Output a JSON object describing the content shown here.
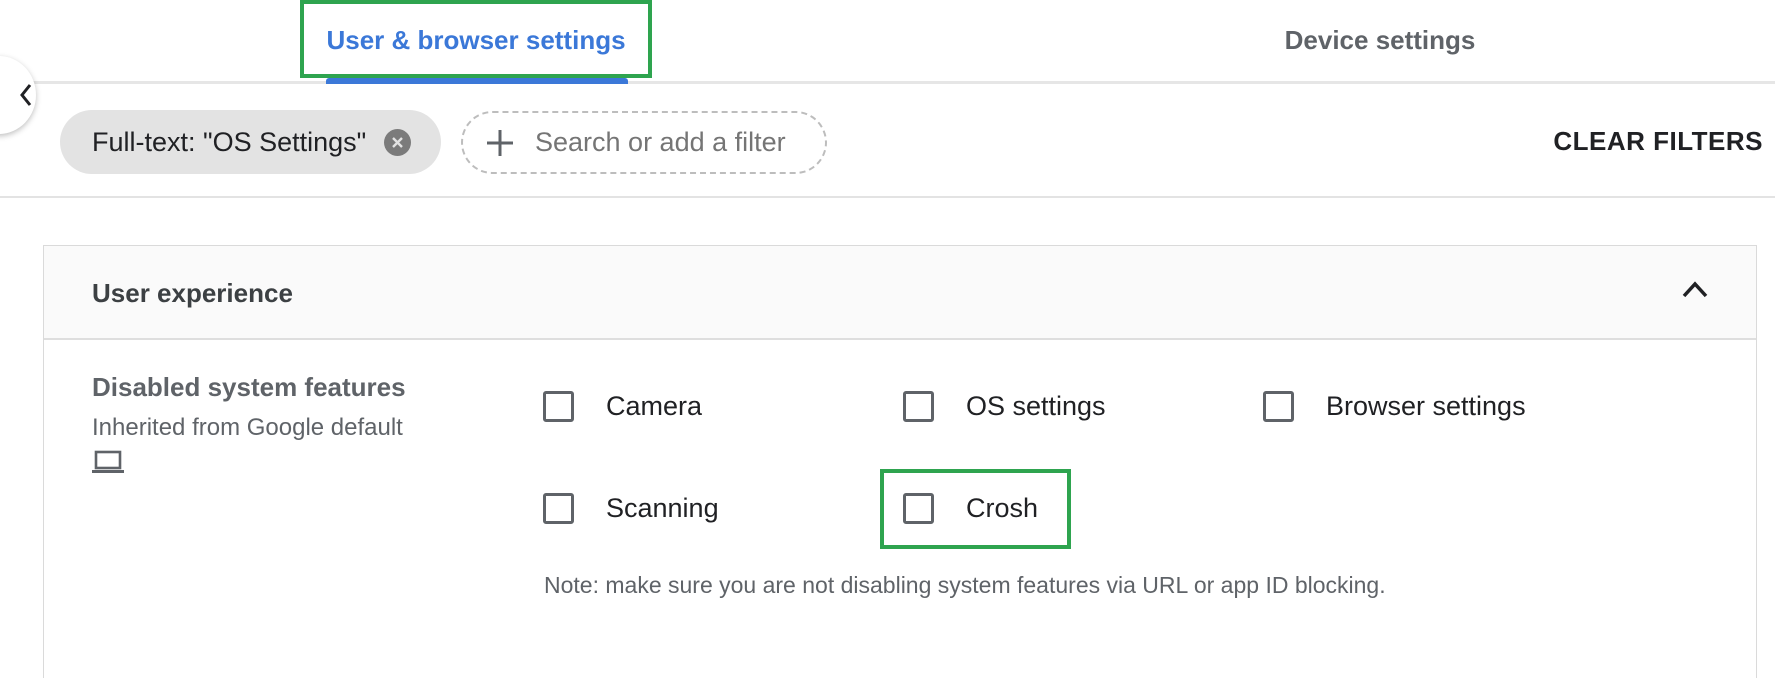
{
  "tabs": {
    "user_browser": "User & browser settings",
    "device": "Device settings",
    "active": "user_browser"
  },
  "filters": {
    "chip_label": "Full-text: \"OS Settings\"",
    "search_placeholder": "Search or add a filter",
    "clear_label": "CLEAR FILTERS"
  },
  "section": {
    "title": "User experience",
    "setting": {
      "name": "Disabled system features",
      "inherited": "Inherited from Google default",
      "options": [
        {
          "label": "Camera",
          "checked": false
        },
        {
          "label": "OS settings",
          "checked": false
        },
        {
          "label": "Browser settings",
          "checked": false
        },
        {
          "label": "Scanning",
          "checked": false
        },
        {
          "label": "Crosh",
          "checked": false
        }
      ],
      "note": "Note: make sure you are not disabling system features via URL or app ID blocking."
    }
  },
  "icons": {
    "chip_close": "close-circle-icon",
    "add_filter": "plus-icon",
    "collapse": "chevron-up-icon",
    "side_toggle": "chevron-left-icon",
    "inherited_source": "laptop-icon"
  },
  "colors": {
    "accent": "#3b78d8",
    "highlight": "#2ea44f"
  }
}
